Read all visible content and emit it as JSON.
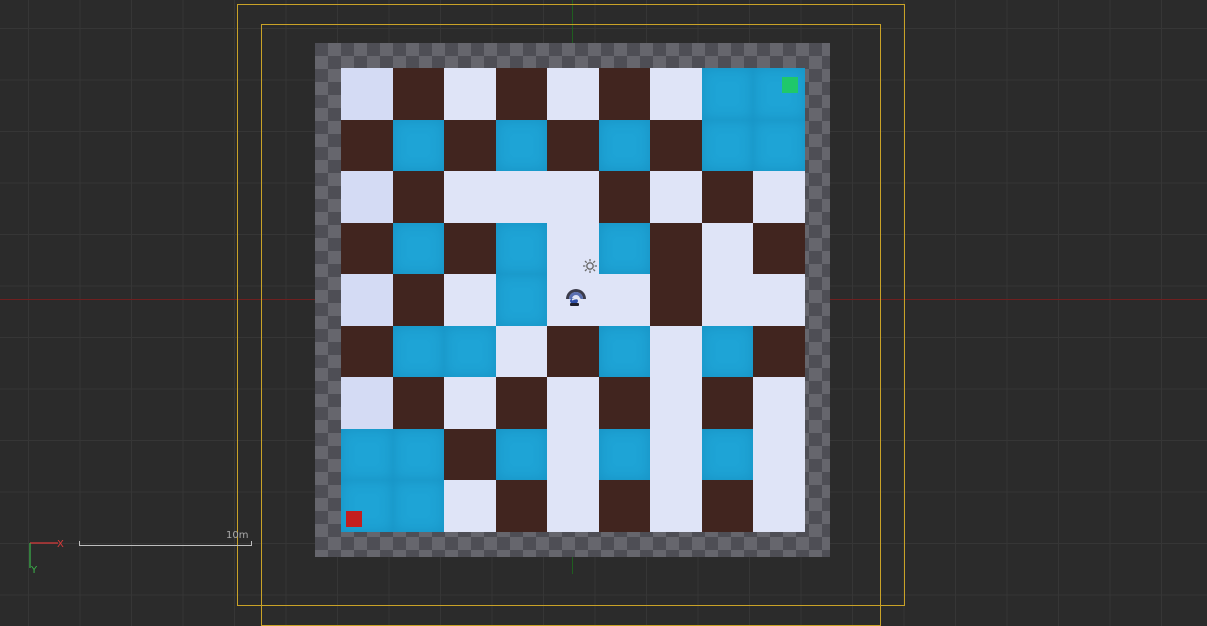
{
  "scene": {
    "grid": [
      [
        "floor",
        "wall",
        "floor",
        "wall",
        "floor",
        "wall",
        "floor",
        "water",
        "water"
      ],
      [
        "wall",
        "water",
        "wall",
        "water",
        "wall",
        "water",
        "wall",
        "water",
        "water"
      ],
      [
        "floor",
        "wall",
        "floor",
        "floor",
        "floor",
        "wall",
        "floor",
        "wall",
        "floor"
      ],
      [
        "wall",
        "water",
        "wall",
        "water",
        "floor",
        "water",
        "wall",
        "floor",
        "wall"
      ],
      [
        "floor",
        "wall",
        "floor",
        "water",
        "floor",
        "floor",
        "wall",
        "floor",
        "floor"
      ],
      [
        "wall",
        "water",
        "water",
        "floor",
        "wall",
        "water",
        "floor",
        "water",
        "wall"
      ],
      [
        "floor",
        "wall",
        "floor",
        "wall",
        "floor",
        "wall",
        "floor",
        "wall",
        "floor"
      ],
      [
        "water",
        "water",
        "wall",
        "water",
        "floor",
        "water",
        "floor",
        "water",
        "floor"
      ],
      [
        "water",
        "water",
        "floor",
        "wall",
        "floor",
        "wall",
        "floor",
        "wall",
        "floor"
      ]
    ],
    "colors": {
      "floor": "#dfe4f7",
      "wall": "#41251f",
      "water": "#1ea4d6",
      "goal": "#1fc86a",
      "start": "#c41e1e",
      "bounds": "#c9a227"
    },
    "icons": [
      "light-icon",
      "agent-icon"
    ]
  },
  "scale_bar": {
    "label": "10m"
  },
  "gizmo": {
    "x_label": "X",
    "y_label": "Y"
  }
}
